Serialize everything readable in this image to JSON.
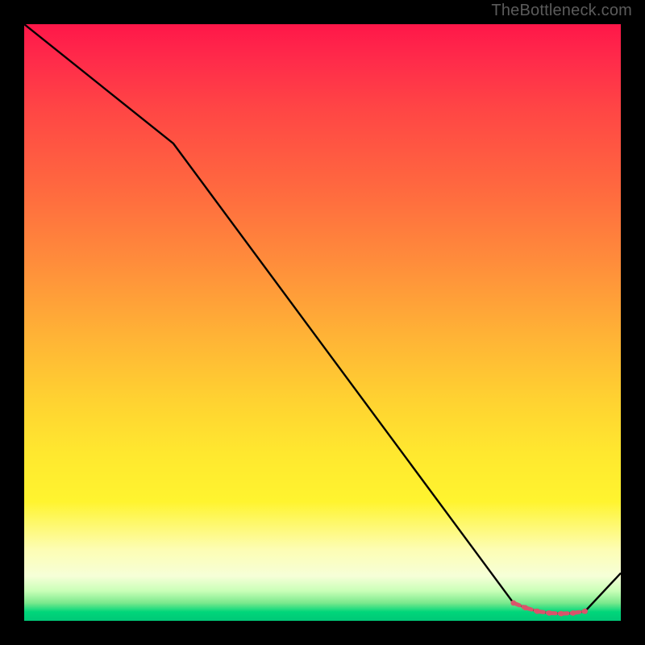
{
  "attribution": "TheBottleneck.com",
  "chart_data": {
    "type": "line",
    "title": "",
    "xlabel": "",
    "ylabel": "",
    "xlim": [
      0,
      100
    ],
    "ylim": [
      0,
      100
    ],
    "series": [
      {
        "name": "curve",
        "x": [
          0,
          25,
          82,
          84,
          86,
          88,
          90,
          92,
          94,
          100
        ],
        "y": [
          100,
          80,
          3,
          2.2,
          1.6,
          1.3,
          1.2,
          1.3,
          1.6,
          8
        ]
      }
    ],
    "markers": {
      "name": "flat-segment",
      "x": [
        82,
        84,
        86,
        88,
        90,
        92,
        94
      ],
      "y": [
        3,
        2.2,
        1.6,
        1.3,
        1.2,
        1.3,
        1.6
      ]
    },
    "gradient_stops": [
      {
        "pos": 0.0,
        "color": "#ff1749"
      },
      {
        "pos": 0.28,
        "color": "#ff6a3f"
      },
      {
        "pos": 0.63,
        "color": "#ffd231"
      },
      {
        "pos": 0.88,
        "color": "#fdfdb3"
      },
      {
        "pos": 0.97,
        "color": "#7be98d"
      },
      {
        "pos": 1.0,
        "color": "#00c877"
      }
    ],
    "line_color": "#000000",
    "marker_color": "#d9546b"
  }
}
